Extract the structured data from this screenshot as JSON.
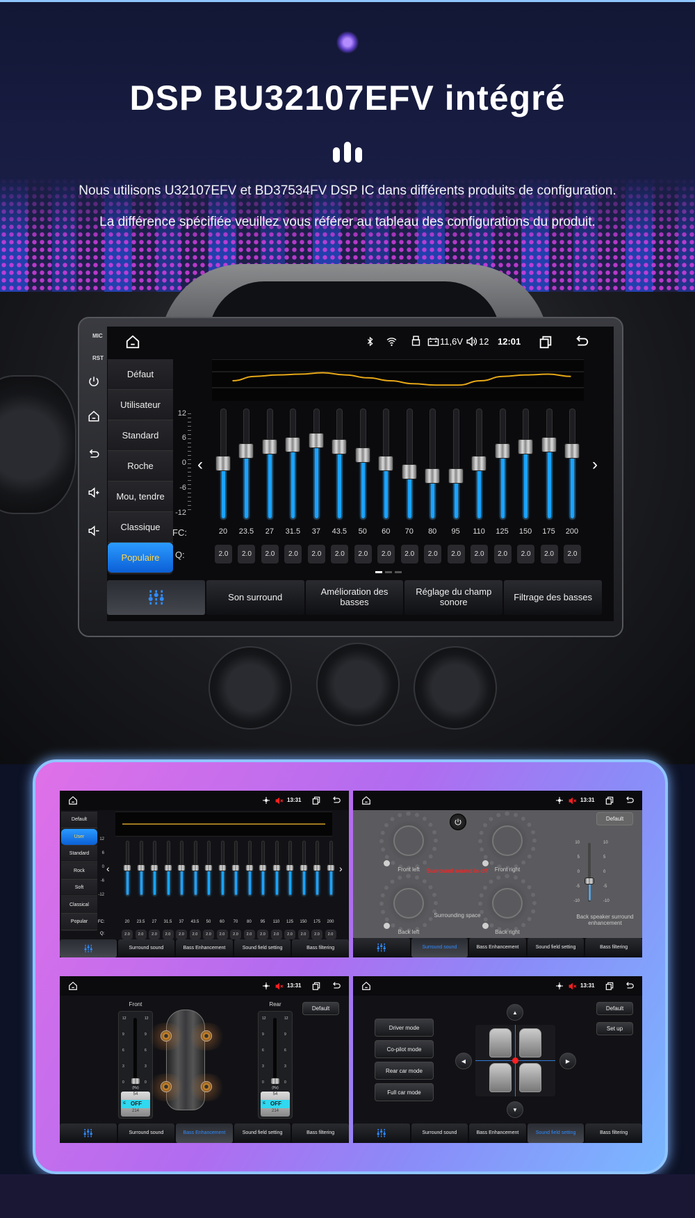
{
  "header": {
    "title": "DSP BU32107EFV intégré",
    "subtitle_line1": "Nous utilisons U32107EFV et BD37534FV DSP IC dans différents produits de configuration.",
    "subtitle_line2": "La différence spécifiée veuillez vous référer au tableau des configurations du produit."
  },
  "colors": {
    "accent_blue": "#1aa3ff",
    "curve_yellow": "#e6a817",
    "active_text": "#ffd54a",
    "mute_red": "#ff2020",
    "frame_gradient": [
      "#e070e8",
      "#b06cf0",
      "#7ab8ff"
    ]
  },
  "main_screen": {
    "side_buttons": {
      "mic": "MIC",
      "rst": "RST",
      "icons": [
        "power-icon",
        "home-icon",
        "back-icon",
        "volume-up-icon",
        "volume-down-icon"
      ]
    },
    "status": {
      "voltage": "11,6V",
      "volume": "12",
      "time": "12:01",
      "icons": [
        "home-icon",
        "bluetooth-icon",
        "wifi-icon",
        "usb-icon",
        "battery-icon",
        "speaker-icon",
        "recent-apps-icon",
        "back-icon"
      ]
    },
    "presets": [
      {
        "label": "Défaut",
        "active": false
      },
      {
        "label": "Utilisateur",
        "active": false
      },
      {
        "label": "Standard",
        "active": false
      },
      {
        "label": "Roche",
        "active": false
      },
      {
        "label": "Mou, tendre",
        "active": false
      },
      {
        "label": "Classique",
        "active": false
      },
      {
        "label": "Populaire",
        "active": true
      }
    ],
    "eq": {
      "y_ticks": [
        "12",
        "6",
        "0",
        "-6",
        "-12"
      ],
      "gain_range_db": [
        -12,
        12
      ],
      "fc_label": "FC:",
      "q_label": "Q:",
      "bands": [
        {
          "fc": "20",
          "q": "2.0",
          "gain_db": 0
        },
        {
          "fc": "23.5",
          "q": "2.0",
          "gain_db": 3
        },
        {
          "fc": "27",
          "q": "2.0",
          "gain_db": 4
        },
        {
          "fc": "31.5",
          "q": "2.0",
          "gain_db": 4.5
        },
        {
          "fc": "37",
          "q": "2.0",
          "gain_db": 5.5
        },
        {
          "fc": "43.5",
          "q": "2.0",
          "gain_db": 4
        },
        {
          "fc": "50",
          "q": "2.0",
          "gain_db": 2
        },
        {
          "fc": "60",
          "q": "2.0",
          "gain_db": 0
        },
        {
          "fc": "70",
          "q": "2.0",
          "gain_db": -2
        },
        {
          "fc": "80",
          "q": "2.0",
          "gain_db": -3
        },
        {
          "fc": "95",
          "q": "2.0",
          "gain_db": -3
        },
        {
          "fc": "110",
          "q": "2.0",
          "gain_db": 0
        },
        {
          "fc": "125",
          "q": "2.0",
          "gain_db": 3
        },
        {
          "fc": "150",
          "q": "2.0",
          "gain_db": 4
        },
        {
          "fc": "175",
          "q": "2.0",
          "gain_db": 4.5
        },
        {
          "fc": "200",
          "q": "2.0",
          "gain_db": 3
        }
      ],
      "page": 1,
      "pages": 3
    },
    "tabs": [
      "",
      "Son surround",
      "Amélioration des basses",
      "Réglage du champ sonore",
      "Filtrage des basses"
    ],
    "active_tab": 0
  },
  "panels": {
    "time": "13:31",
    "tabs": [
      "",
      "Surround sound",
      "Bass Enhancement",
      "Sound field setting",
      "Bass filtering"
    ],
    "equalizer": {
      "active_tab": 0,
      "presets": [
        {
          "label": "Default",
          "active": false
        },
        {
          "label": "User",
          "active": true
        },
        {
          "label": "Standard",
          "active": false
        },
        {
          "label": "Rock",
          "active": false
        },
        {
          "label": "Soft",
          "active": false
        },
        {
          "label": "Classical",
          "active": false
        },
        {
          "label": "Popular",
          "active": false
        }
      ],
      "y_ticks": [
        "12",
        "6",
        "0",
        "-6",
        "-12"
      ],
      "fc_label": "FC:",
      "q_label": "Q:",
      "fc": [
        "20",
        "23.5",
        "27",
        "31.5",
        "37",
        "43.5",
        "50",
        "60",
        "70",
        "80",
        "95",
        "110",
        "125",
        "150",
        "175",
        "200"
      ],
      "q": "2.0",
      "gain_db": 0
    },
    "surround": {
      "active_tab": 1,
      "default_label": "Default",
      "status": "Surround sound is off",
      "dials": [
        "Front left",
        "Front right",
        "Back left",
        "Back right"
      ],
      "space_label": "Surrounding space",
      "scale": [
        "10",
        "5",
        "0",
        "-5",
        "-10"
      ],
      "enhancement_label": "Back speaker surround enhancement",
      "enhancement_level": -3
    },
    "bass": {
      "active_tab": 2,
      "front_label": "Front",
      "rear_label": "Rear",
      "default_label": "Default",
      "scale": [
        "12",
        "9",
        "6",
        "3",
        "0"
      ],
      "unit": "(Hz)",
      "picker": {
        "above": "54",
        "selected": "OFF",
        "below": "214",
        "prefix": "≤"
      },
      "level": 0
    },
    "sound_field": {
      "active_tab": 3,
      "modes": [
        "Driver mode",
        "Co-pilot mode",
        "Rear car mode",
        "Full car mode"
      ],
      "default_label": "Default",
      "setup_label": "Set up"
    }
  }
}
